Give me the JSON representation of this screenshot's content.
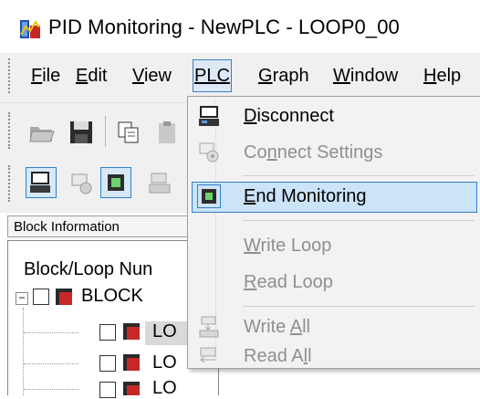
{
  "window": {
    "title": "PID Monitoring - NewPLC - LOOP0_00",
    "icon": "pid-monitor-app-icon"
  },
  "menubar": {
    "items": [
      {
        "key": "F",
        "rest": "ile",
        "full": "File"
      },
      {
        "key": "E",
        "rest": "dit",
        "full": "Edit"
      },
      {
        "key": "V",
        "rest": "iew",
        "full": "View"
      },
      {
        "key": "",
        "rest": "PLC",
        "full": "PLC",
        "active": true
      },
      {
        "key": "G",
        "rest": "raph",
        "full": "Graph"
      },
      {
        "key": "W",
        "rest": "indow",
        "full": "Window"
      },
      {
        "key": "H",
        "rest": "elp",
        "full": "Help"
      }
    ]
  },
  "plc_menu": {
    "items": [
      {
        "pre": "",
        "key": "D",
        "post": "isconnect",
        "enabled": true,
        "icon": "plc-connected-icon"
      },
      {
        "pre": "Co",
        "key": "n",
        "post": "nect Settings",
        "enabled": false,
        "icon": "connect-settings-icon"
      },
      {
        "pre": "",
        "key": "E",
        "post": "nd Monitoring",
        "enabled": true,
        "highlighted": true,
        "icon": "monitoring-icon"
      },
      {
        "pre": "",
        "key": "W",
        "post": "rite Loop",
        "enabled": false,
        "icon": ""
      },
      {
        "pre": "",
        "key": "R",
        "post": "ead Loop",
        "enabled": false,
        "icon": ""
      },
      {
        "pre": "Write ",
        "key": "A",
        "post": "ll",
        "enabled": false,
        "icon": "write-all-icon"
      },
      {
        "pre": "Read A",
        "key": "l",
        "post": "l",
        "enabled": false,
        "icon": "read-all-icon"
      }
    ]
  },
  "panel": {
    "tab_label": "Block Information",
    "header": "Block/Loop Nun",
    "block_label": "BLOCK",
    "loop_label": "LO"
  },
  "colors": {
    "highlight": "#cce4f7",
    "highlight_border": "#2f7fd0",
    "disabled_text": "#8f8f8f"
  }
}
